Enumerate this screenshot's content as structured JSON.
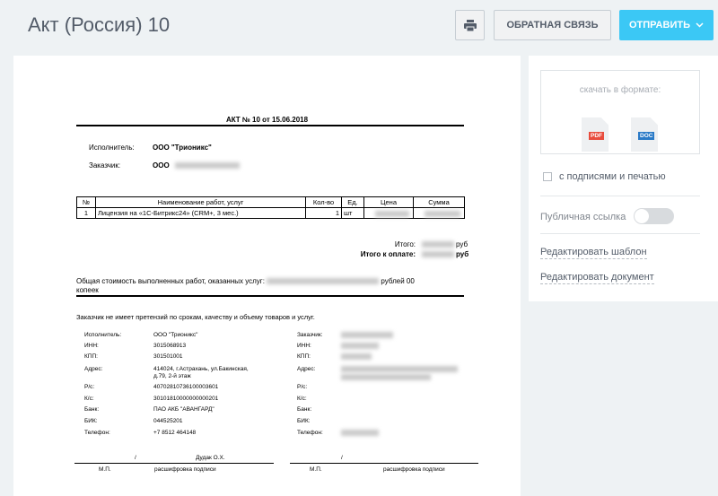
{
  "header": {
    "title": "Акт (Россия) 10",
    "print_icon": "printer-icon",
    "feedback_label": "ОБРАТНАЯ СВЯЗЬ",
    "send_label": "ОТПРАВИТЬ",
    "send_icon": "chevron-down-icon"
  },
  "document": {
    "title": "АКТ № 10 от 15.06.2018",
    "executor_label": "Исполнитель:",
    "executor_value": "ООО \"Трионикс\"",
    "customer_label": "Заказчик:",
    "customer_value": "ООО",
    "table": {
      "headers": [
        "№",
        "Наименование работ, услуг",
        "Кол-во",
        "Ед.",
        "Цена",
        "Сумма"
      ],
      "rows": [
        {
          "no": "1",
          "name": "Лицензия на «1С-Битрикс24» (CRM+, 3 мес.)",
          "qty": "1",
          "unit": "шт"
        }
      ]
    },
    "total_label": "Итого:",
    "total_to_pay_label": "Итого к оплате:",
    "currency_suffix": "руб",
    "total_text_prefix": "Общая стоимость выполненных работ, оказанных услуг:",
    "total_text_suffix": "рублей 00",
    "total_text_kopeks": "копеек",
    "claims": "Заказчик не имеет претензий по срокам, качеству и объему товаров и услуг.",
    "requisites": {
      "executor_label": "Исполнитель:",
      "executor_value": "ООО \"Трионикс\"",
      "inn_label": "ИНН:",
      "inn_value": "3015068913",
      "kpp_label": "КПП:",
      "kpp_value": "301501001",
      "address_label": "Адрес:",
      "address_value_1": "414024, г.Астрахань, ул.Бакинская,",
      "address_value_2": "д.79, 2-й этаж",
      "rs_label": "Р/с:",
      "rs_value": "40702810736100003601",
      "ks_label": "К/с:",
      "ks_value": "30101810000000000201",
      "bank_label": "Банк:",
      "bank_value": "ПАО АКБ \"АВАНГАРД\"",
      "bik_label": "БИК:",
      "bik_value": "044525201",
      "phone_label": "Телефон:",
      "phone_value": "+7 8512 464148",
      "customer_label": "Заказчик:",
      "sign_slash": "/",
      "sign_name": "Дудак О.Х.",
      "mp": "М.П.",
      "decode": "расшифровка подписи"
    }
  },
  "panel": {
    "download_label": "скачать в формате:",
    "pdf_label": "PDF",
    "doc_label": "DOC",
    "pdf_icon": "pdf-file-icon",
    "doc_icon": "doc-file-icon",
    "signatures_label": "с подписями и печатью",
    "public_link_label": "Публичная ссылка",
    "public_link_enabled": false,
    "edit_template_label": "Редактировать шаблон",
    "edit_document_label": "Редактировать документ"
  }
}
